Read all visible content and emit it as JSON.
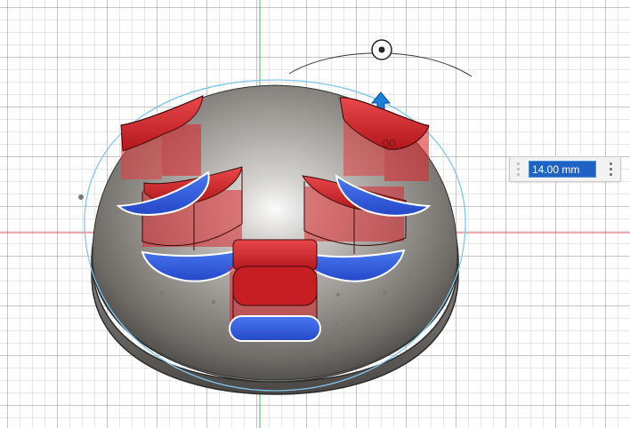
{
  "app": {
    "view": "canvas-viewport"
  },
  "dimension_input": {
    "value": "14.00 mm",
    "menu_icon": "vertical-ellipsis-icon"
  },
  "model": {
    "ghost_value_label": "00"
  },
  "manipulators": {
    "rotate_handle_icon": "rotate-handle-icon",
    "extrude_arrow_icon": "up-arrow-icon"
  },
  "colors": {
    "grid_major": "#969696",
    "grid_minor": "#bebebe",
    "axis_red": "#e05a5a",
    "axis_green": "#40c040",
    "body_gray": "#8f8b86",
    "extrude_red": "#d8242a",
    "profile_blue": "#2c5ee6",
    "selection_cyan": "#7fc6ee",
    "input_highlight": "#1e63c4"
  }
}
